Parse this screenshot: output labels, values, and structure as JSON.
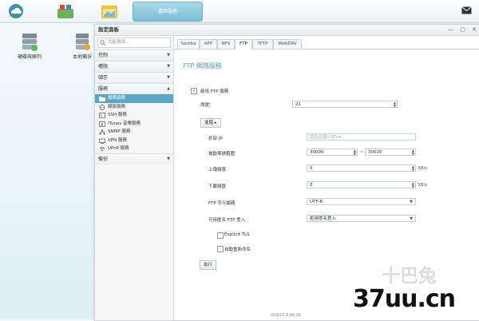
{
  "taskbar": {
    "active_app": "檔案服務"
  },
  "desktop": [
    {
      "label": "硬碟與陣列"
    },
    {
      "label": "本地備份"
    }
  ],
  "window": {
    "title": "設定面板",
    "controls": [
      "—",
      "▢",
      "✕"
    ]
  },
  "sidebar": {
    "search_placeholder": "功能搜尋...",
    "categories": [
      {
        "label": "控制",
        "arrow": "▼"
      },
      {
        "label": "權限",
        "arrow": "▼"
      },
      {
        "label": "儲存",
        "arrow": "▼"
      },
      {
        "label": "服務",
        "arrow": "▲"
      }
    ],
    "items": [
      {
        "label": "檔案服務",
        "icon": "folder-icon",
        "selected": true
      },
      {
        "label": "網頁服務",
        "icon": "globe-icon"
      },
      {
        "label": "SSH 服務",
        "icon": "terminal-icon"
      },
      {
        "label": "iTunes 音樂服務",
        "icon": "music-icon"
      },
      {
        "label": "SNMP 服務",
        "icon": "network-icon"
      },
      {
        "label": "VPN 服務",
        "icon": "vpn-icon"
      },
      {
        "label": "UPnP 服務",
        "icon": "upnp-icon"
      }
    ],
    "backup": {
      "label": "備份",
      "arrow": "▼"
    }
  },
  "tabs": [
    "Samba",
    "AFP",
    "NFS",
    "FTP",
    "TFTP",
    "WebDAV"
  ],
  "active_tab": "FTP",
  "ftp": {
    "section_title": "FTP 網路服務",
    "enable_label": "啟用 FTP 服務",
    "enable_checked": "✓",
    "port_label": "埠號：",
    "port_value": "21",
    "advanced_label": "進階 ▸",
    "external_ip_label": "外部 IP",
    "external_ip_placeholder": "請在此輸入IPv4",
    "passive_label": "被動埠號範圍",
    "passive_from": "30000",
    "passive_sep": "~",
    "passive_to": "30020",
    "upload_label": "上傳頻寬",
    "upload_value": "0",
    "download_label": "下載頻寬",
    "download_value": "0",
    "unit": "KB/s",
    "encoding_label": "FTP 字元編碼",
    "encoding_value": "UTF-8",
    "anonymous_label": "可用匿名 FTP 登入",
    "anonymous_value": "拒絕匿名登入",
    "explicit_tls_label": "Explicit TLS",
    "auto_rename_label": "自動重新命名",
    "execute_label": "執行"
  },
  "footer": "N2810  3.00.01",
  "watermark": {
    "top": "十巴兔",
    "bottom": "37uu.cn"
  },
  "colors": {
    "accent": "#5aa5c8",
    "selected": "#5aa5c8"
  }
}
